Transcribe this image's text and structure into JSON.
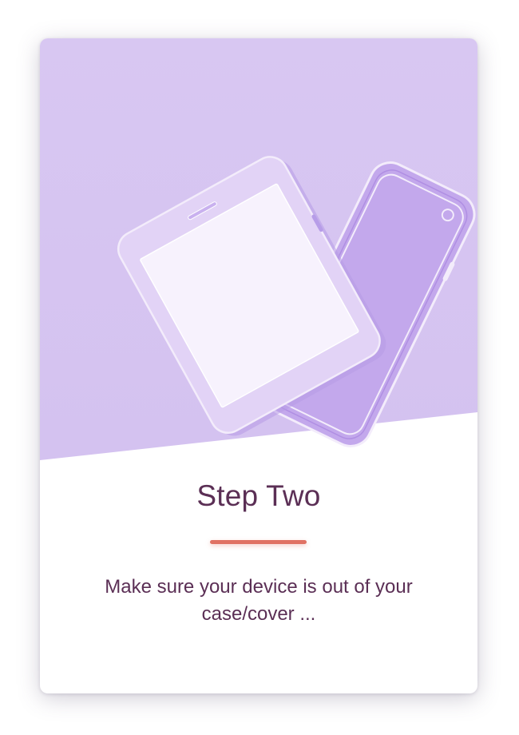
{
  "step": {
    "title": "Step Two",
    "description": "Make sure your device is out of your case/cover ..."
  },
  "illustration": {
    "name": "phone-and-case-illustration",
    "alt": "A smartphone lying next to its empty protective case"
  },
  "colors": {
    "hero_bg": "#d4c2f0",
    "hero_bg_top": "#d8c7f2",
    "accent": "#e07264",
    "text": "#5b2f55",
    "case_fill": "#c3a8ec",
    "case_stroke": "#f3ecfb",
    "phone_body": "#e2d3f6",
    "phone_screen": "#f7f2fd"
  }
}
